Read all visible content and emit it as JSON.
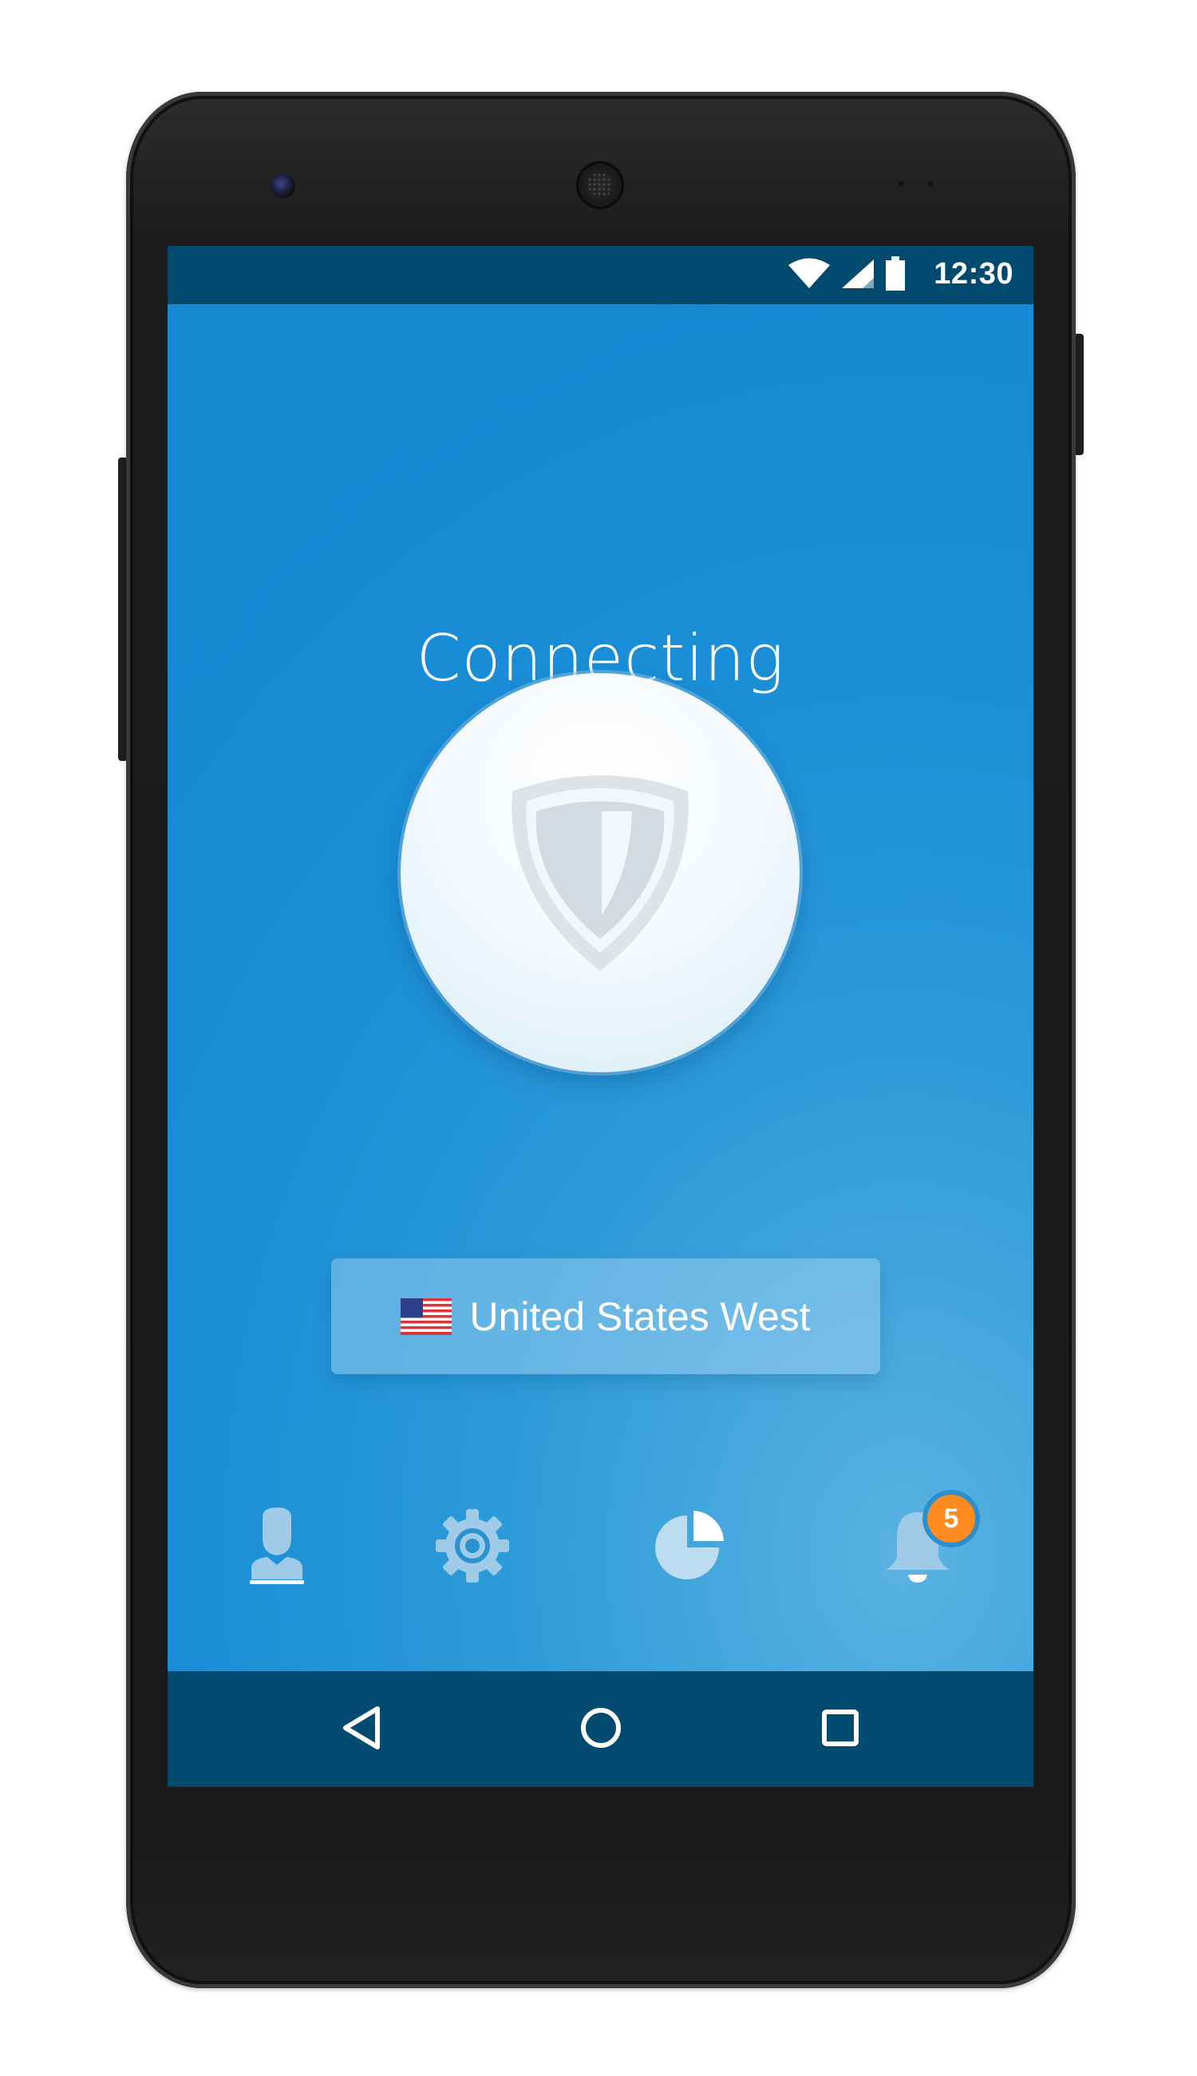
{
  "status_bar": {
    "time": "12:30",
    "icons": [
      "wifi-icon",
      "cell-signal-icon",
      "battery-icon"
    ]
  },
  "main": {
    "status_title": "Connecting",
    "connect_button_icon": "shield-icon",
    "location": {
      "flag_icon": "us-flag-icon",
      "label": "United States West"
    }
  },
  "bottom_nav": {
    "items": [
      {
        "icon": "account-icon"
      },
      {
        "icon": "settings-gear-icon"
      },
      {
        "icon": "stats-pie-icon"
      },
      {
        "icon": "notifications-bell-icon",
        "badge": "5"
      }
    ]
  },
  "system_nav": {
    "buttons": [
      "back-icon",
      "home-icon",
      "recents-icon"
    ]
  },
  "colors": {
    "status_bar_bg": "#004a70",
    "screen_gradient_from": "#1689d3",
    "screen_gradient_to": "#5ab2e2",
    "badge": "#ff8a1f",
    "icon_tint": "#cfe6f5"
  }
}
